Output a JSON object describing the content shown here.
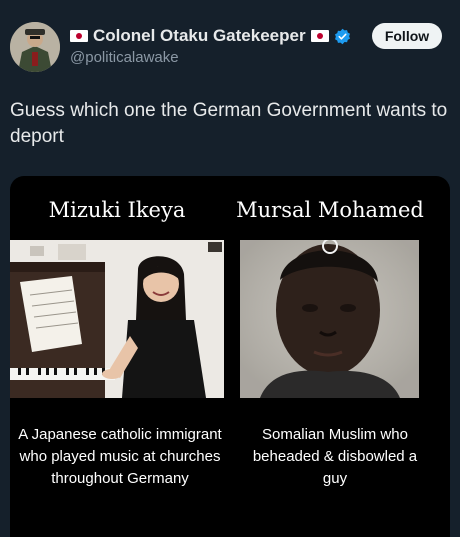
{
  "tweet": {
    "author": {
      "display_name": "Colonel Otaku Gatekeeper",
      "handle": "@politicalawake",
      "flag_icon": "japan-flag-icon",
      "verified_icon": "verified-badge-icon",
      "verified_color": "#1d9bf0"
    },
    "follow_label": "Follow",
    "text": "Guess which one the German Government wants to deport",
    "media": {
      "left": {
        "title": "Mizuki Ikeya",
        "caption": "A Japanese catholic immigrant who played music at churches throughout Germany"
      },
      "right": {
        "title": "Mursal Mohamed",
        "caption": "Somalian Muslim who beheaded & disbowled a guy"
      }
    }
  }
}
